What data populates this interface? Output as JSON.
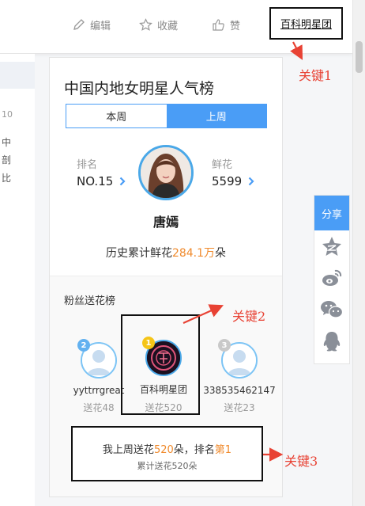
{
  "toolbar": {
    "edit_label": "编辑",
    "favorite_label": "收藏",
    "like_label": "赞",
    "baike_link": "百科明星团"
  },
  "left_column": {
    "fragments": [
      "10",
      "中",
      "剖",
      "比"
    ]
  },
  "ranking": {
    "title": "中国内地女明星人气榜",
    "tabs": [
      {
        "label": "本周",
        "active": false
      },
      {
        "label": "上周",
        "active": true
      }
    ],
    "rank_label": "排名",
    "rank_value": "NO.15",
    "flower_label": "鲜花",
    "flower_value": "5599",
    "star_name": "唐嫣",
    "history_prefix": "历史累计鲜花",
    "history_value": "284.1万",
    "history_suffix": "朵"
  },
  "fans": {
    "title": "粉丝送花榜",
    "list": [
      {
        "rank": "1",
        "name": "百科明星团",
        "sub": "送花520",
        "rank_color": "#f5c518"
      },
      {
        "rank": "2",
        "name": "yyttrrgreat",
        "sub": "送花48",
        "rank_color": "#62b1f0"
      },
      {
        "rank": "3",
        "name": "338535462147",
        "sub": "送花23",
        "rank_color": "#c9c9c9"
      }
    ],
    "my_prefix": "我上周送花",
    "my_count": "520",
    "my_middle": "朵，排名",
    "my_rank": "第1",
    "my_total": "累计送花520朵"
  },
  "share": {
    "label": "分享",
    "icons": [
      "qzone-star-icon",
      "weibo-icon",
      "wechat-icon",
      "qq-penguin-icon"
    ]
  },
  "annotations": {
    "a1": "关键1",
    "a2": "关键2",
    "a3": "关键3"
  },
  "colors": {
    "accent_blue": "#4a9df6",
    "highlight_orange": "#f08a2c",
    "annotation_red": "#e84234"
  }
}
